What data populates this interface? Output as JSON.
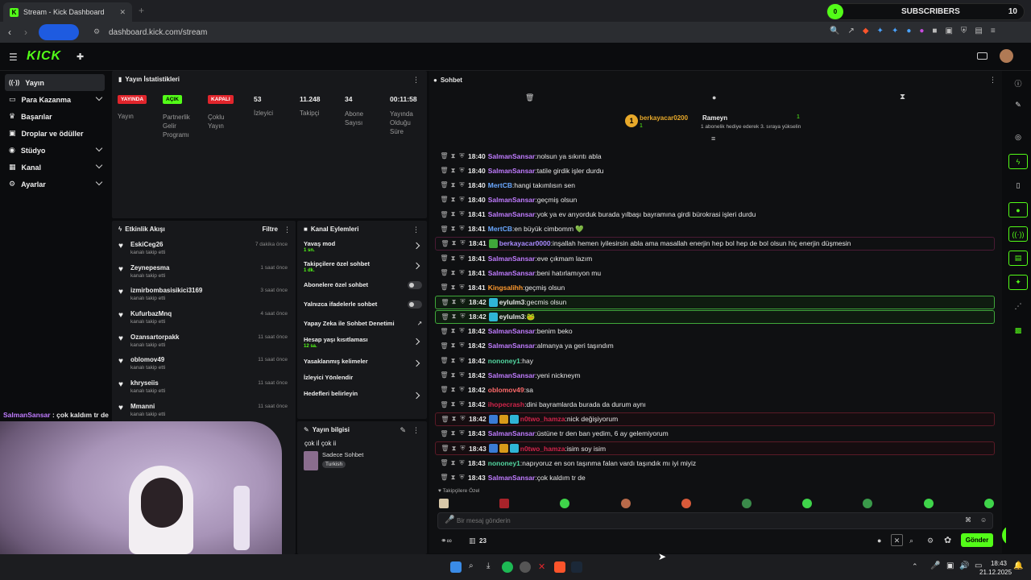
{
  "browser": {
    "tab_title": "Stream - Kick Dashboard",
    "url": "dashboard.kick.com/stream",
    "subscribers": {
      "label": "SUBSCRIBERS",
      "count": "10",
      "progress": "0"
    }
  },
  "nav": {
    "items": [
      {
        "label": "Yayın",
        "icon": "broadcast-icon",
        "active": true
      },
      {
        "label": "Para Kazanma",
        "icon": "dollar-icon",
        "expand": true
      },
      {
        "label": "Başarılar",
        "icon": "trophy-icon"
      },
      {
        "label": "Droplar ve ödüller",
        "icon": "gift-icon"
      },
      {
        "label": "Stüdyo",
        "icon": "studio-icon",
        "expand": true
      },
      {
        "label": "Kanal",
        "icon": "channel-icon",
        "expand": true
      },
      {
        "label": "Ayarlar",
        "icon": "gear-icon",
        "expand": true
      }
    ]
  },
  "stats": {
    "title": "Yayın İstatistikleri",
    "items": [
      {
        "badge": "YAYINDA",
        "badge_color": "#e1252c",
        "label": "Yayın"
      },
      {
        "badge": "AÇIK",
        "badge_color": "#53fc18",
        "label": "Partnerlik Gelir Programı"
      },
      {
        "badge": "KAPALI",
        "badge_color": "#e1252c",
        "label": "Çoklu Yayın"
      },
      {
        "value": "53",
        "label": "İzleyici"
      },
      {
        "value": "11.248",
        "label": "Takipçi"
      },
      {
        "value": "34",
        "label": "Abone Sayısı"
      },
      {
        "value": "00:11:58",
        "label": "Yayında Olduğu Süre"
      }
    ]
  },
  "activity": {
    "title": "Etkinlik Akışı",
    "filter": "Filtre",
    "items": [
      {
        "name": "EskiCeg26",
        "sub": "kanalı takip etti",
        "time": "7 dakika önce"
      },
      {
        "name": "Zeynepesma",
        "sub": "kanalı takip etti",
        "time": "1 saat önce"
      },
      {
        "name": "izmirbombasisikici3169",
        "sub": "kanalı takip etti",
        "time": "3 saat önce"
      },
      {
        "name": "KufurbazMnq",
        "sub": "kanalı takip etti",
        "time": "4 saat önce"
      },
      {
        "name": "Ozansartorpakk",
        "sub": "kanalı takip etti",
        "time": "11 saat önce"
      },
      {
        "name": "oblomov49",
        "sub": "kanalı takip etti",
        "time": "11 saat önce"
      },
      {
        "name": "khryseiis",
        "sub": "kanalı takip etti",
        "time": "11 saat önce"
      },
      {
        "name": "Mmanni",
        "sub": "kanalı takip etti",
        "time": "11 saat önce"
      }
    ]
  },
  "mod": {
    "title": "Kanal Eylemleri",
    "items": [
      {
        "label": "Yavaş mod",
        "sub": "1 sn.",
        "ctl": "arrow"
      },
      {
        "label": "Takipçilere özel sohbet",
        "sub": "1 dk.",
        "ctl": "arrow"
      },
      {
        "label": "Abonelere özel sohbet",
        "ctl": "toggle"
      },
      {
        "label": "Yalnızca ifadelerle sohbet",
        "ctl": "toggle"
      },
      {
        "label": "Yapay Zeka ile Sohbet Denetimi",
        "ctl": "ext"
      },
      {
        "label": "Hesap yaşı kısıtlaması",
        "sub": "12 sa.",
        "ctl": "arrow"
      },
      {
        "label": "Yasaklanmış kelimeler",
        "ctl": "arrow"
      },
      {
        "label": "İzleyici Yönlendir",
        "ctl": "none"
      },
      {
        "label": "Hedefleri belirleyin",
        "ctl": "arrow"
      }
    ]
  },
  "streaminfo": {
    "title": "Yayın bilgisi",
    "stream_title": "çok iİ çok ii",
    "category": "Sadece Sohbet",
    "tag": "Turkish"
  },
  "chat": {
    "title": "Sohbet",
    "pinned": {
      "gifter": "berkayacar0200",
      "gifter_rank": "1",
      "gift_count": "1",
      "recipient": "Rameyn",
      "recipient_count": "1",
      "note": "1 abonelik hediye ederek 3. sıraya yükselin"
    },
    "messages": [
      {
        "time": "18:40",
        "user": "SalmanSansar",
        "color": "#c07cff",
        "text": "nolsun ya sıkıntı abla"
      },
      {
        "time": "18:40",
        "user": "SalmanSansar",
        "color": "#c07cff",
        "text": "tatile girdik işler durdu"
      },
      {
        "time": "18:40",
        "user": "MertCB",
        "color": "#6aa8ff",
        "text": "hangi takımlısın sen"
      },
      {
        "time": "18:40",
        "user": "SalmanSansar",
        "color": "#c07cff",
        "text": "geçmiş olsun"
      },
      {
        "time": "18:41",
        "user": "SalmanSansar",
        "color": "#c07cff",
        "text": "yok ya ev arıyorduk burada yılbaşı bayramına girdi bürokrasi işleri durdu"
      },
      {
        "time": "18:41",
        "user": "MertCB",
        "color": "#6aa8ff",
        "text": "en büyük cimbomm 💚"
      },
      {
        "time": "18:41",
        "user": "berkayacar0000",
        "color": "#a98bff",
        "text": "inşallah hemen iyilesirsin abla ama masallah enerjin hep bol hep de bol olsun hiç enerjin düşmesin",
        "hl": "pink",
        "badges": [
          "#3fa83a"
        ]
      },
      {
        "time": "18:41",
        "user": "SalmanSansar",
        "color": "#c07cff",
        "text": "eve çıkmam lazım"
      },
      {
        "time": "18:41",
        "user": "SalmanSansar",
        "color": "#c07cff",
        "text": "beni hatırlamıyon mu"
      },
      {
        "time": "18:41",
        "user": "Kingsalihh",
        "color": "#ff9a2e",
        "text": "geçmiş olsun"
      },
      {
        "time": "18:42",
        "user": "eylulm3",
        "color": "#e8e8e8",
        "text": "gecmis olsun",
        "hl": "green",
        "badges": [
          "#2fb5d6"
        ]
      },
      {
        "time": "18:42",
        "user": "eylulm3",
        "color": "#e8e8e8",
        "text": "🐸",
        "hl": "green",
        "badges": [
          "#2fb5d6"
        ]
      },
      {
        "time": "18:42",
        "user": "SalmanSansar",
        "color": "#c07cff",
        "text": "benim beko"
      },
      {
        "time": "18:42",
        "user": "SalmanSansar",
        "color": "#c07cff",
        "text": "almanya ya geri taşındım"
      },
      {
        "time": "18:42",
        "user": "nononey1",
        "color": "#53d6a0",
        "text": "hay"
      },
      {
        "time": "18:42",
        "user": "SalmanSansar",
        "color": "#c07cff",
        "text": "yeni nickneym"
      },
      {
        "time": "18:42",
        "user": "oblomov49",
        "color": "#ff6a6a",
        "text": "sa"
      },
      {
        "time": "18:42",
        "user": "ihopecrash",
        "color": "#d0244a",
        "text": "dini bayramlarda burada da durum aynı"
      },
      {
        "time": "18:42",
        "user": "n0two_hamza",
        "color": "#d0244a",
        "text": "nick değişiyorum",
        "hl": "red",
        "badges": [
          "#3a7bd5",
          "#d89a1a",
          "#2fb5d6"
        ]
      },
      {
        "time": "18:43",
        "user": "SalmanSansar",
        "color": "#c07cff",
        "text": "üstüne tr den ban yedim, 6 ay gelemiyorum"
      },
      {
        "time": "18:43",
        "user": "n0two_hamza",
        "color": "#d0244a",
        "text": "isim soy isim",
        "hl": "red",
        "badges": [
          "#3a7bd5",
          "#d89a1a",
          "#2fb5d6"
        ]
      },
      {
        "time": "18:43",
        "user": "nononey1",
        "color": "#53d6a0",
        "text": "napıyoruz en son taşınma falan vardı taşındık mı iyi miyiz"
      },
      {
        "time": "18:43",
        "user": "SalmanSansar",
        "color": "#c07cff",
        "text": "çok kaldım tr de"
      }
    ],
    "followers_only": "Takipçilere Özel",
    "input_placeholder": "Bir mesaj gönderin",
    "viewer_count": "23",
    "send": "Gönder"
  },
  "overlay": {
    "user": "SalmanSansar",
    "text": "çok kaldım tr de"
  },
  "taskbar": {
    "time": "18:43",
    "date": "21.12.2025"
  },
  "colors": {
    "accent": "#53fc18",
    "live": "#e1252c",
    "panel": "#17181b"
  }
}
